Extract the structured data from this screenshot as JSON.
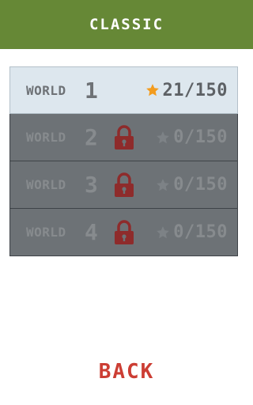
{
  "header": {
    "title": "CLASSIC"
  },
  "colors": {
    "header_bg": "#668836",
    "star_unlocked": "#f39c1e",
    "star_locked": "#7d8286",
    "lock": "#8e2b2b",
    "back": "#cc3e34"
  },
  "worlds": [
    {
      "label": "WORLD",
      "number": "1",
      "score": "21/150",
      "locked": false,
      "icon": "star-icon"
    },
    {
      "label": "WORLD",
      "number": "2",
      "score": "0/150",
      "locked": true,
      "icon": "lock-icon"
    },
    {
      "label": "WORLD",
      "number": "3",
      "score": "0/150",
      "locked": true,
      "icon": "lock-icon"
    },
    {
      "label": "WORLD",
      "number": "4",
      "score": "0/150",
      "locked": true,
      "icon": "lock-icon"
    }
  ],
  "back": {
    "label": "BACK"
  }
}
